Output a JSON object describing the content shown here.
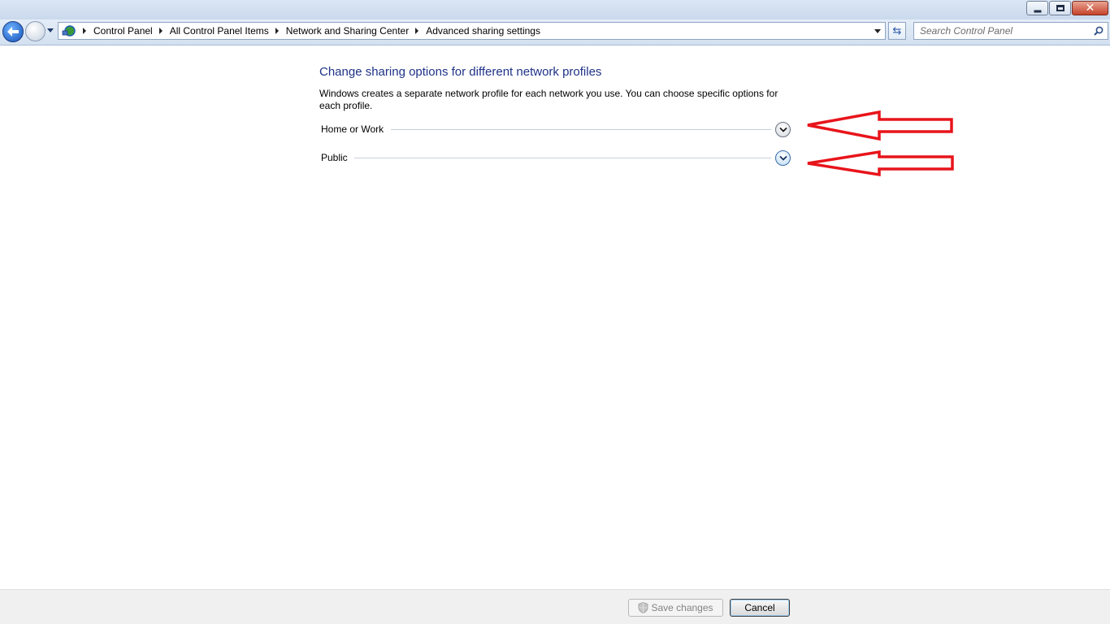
{
  "window": {
    "controls": {
      "minimize_icon": "minimize-icon",
      "maximize_icon": "restore-icon",
      "close_label": "✕"
    }
  },
  "navigation": {
    "breadcrumbs": [
      "Control Panel",
      "All Control Panel Items",
      "Network and Sharing Center",
      "Advanced sharing settings"
    ],
    "refresh_glyph": "⇆",
    "search": {
      "placeholder": "Search Control Panel"
    }
  },
  "main": {
    "heading": "Change sharing options for different network profiles",
    "description": "Windows creates a separate network profile for each network you use. You can choose specific options for each profile.",
    "profiles": [
      {
        "label": "Home or Work",
        "expanded": false
      },
      {
        "label": "Public",
        "expanded": false
      }
    ]
  },
  "footer": {
    "save_label": "Save changes",
    "cancel_label": "Cancel"
  },
  "colors": {
    "heading": "#1e3287",
    "annotation_arrow": "#e8141b"
  }
}
